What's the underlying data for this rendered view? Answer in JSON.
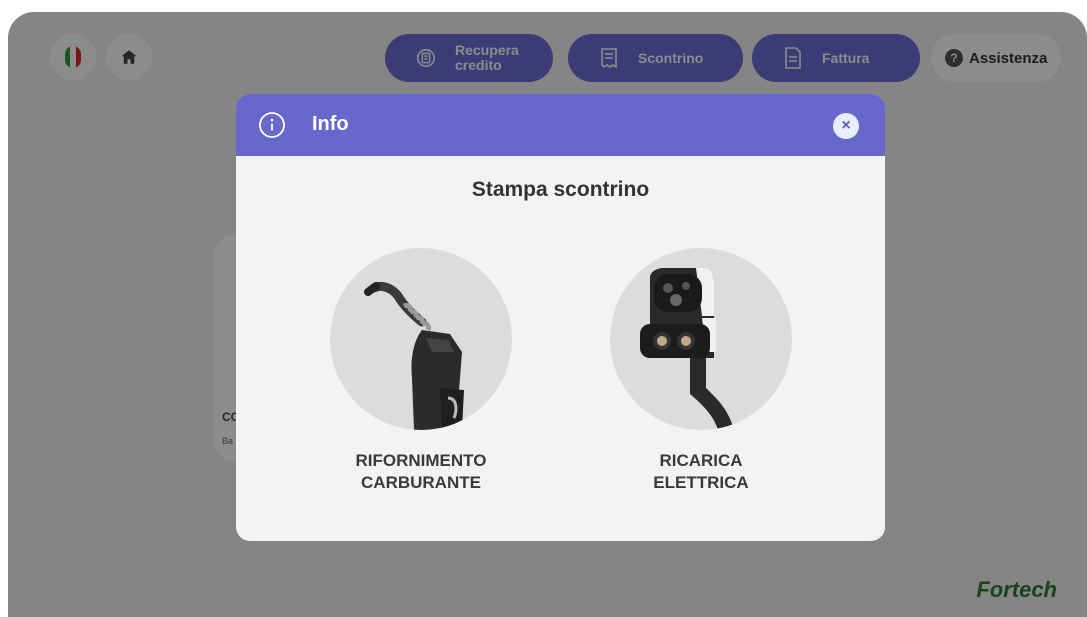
{
  "header": {
    "language_flag": "flag-italy-icon",
    "home_icon": "home-icon",
    "buttons": {
      "recupera_credito": "Recupera\ncredito",
      "scontrino": "Scontrino",
      "fattura": "Fattura",
      "assistenza": "Assistenza"
    },
    "assist_glyph": "?"
  },
  "background_card": {
    "title_fragment": "CC",
    "subtitle_fragment": "Ba"
  },
  "brand": {
    "name": "Fortech"
  },
  "modal": {
    "title": "Info",
    "close_glyph": "×",
    "heading": "Stampa scontrino",
    "options": [
      {
        "label_line1": "RIFORNIMENTO",
        "label_line2": "CARBURANTE",
        "icon": "fuel-nozzle-icon"
      },
      {
        "label_line1": "RICARICA",
        "label_line2": "ELETTRICA",
        "icon": "ev-charger-plug-icon"
      }
    ]
  },
  "colors": {
    "accent": "#6767cc",
    "button_purple": "#6c6cd6",
    "brand_green": "#2e7d32"
  }
}
